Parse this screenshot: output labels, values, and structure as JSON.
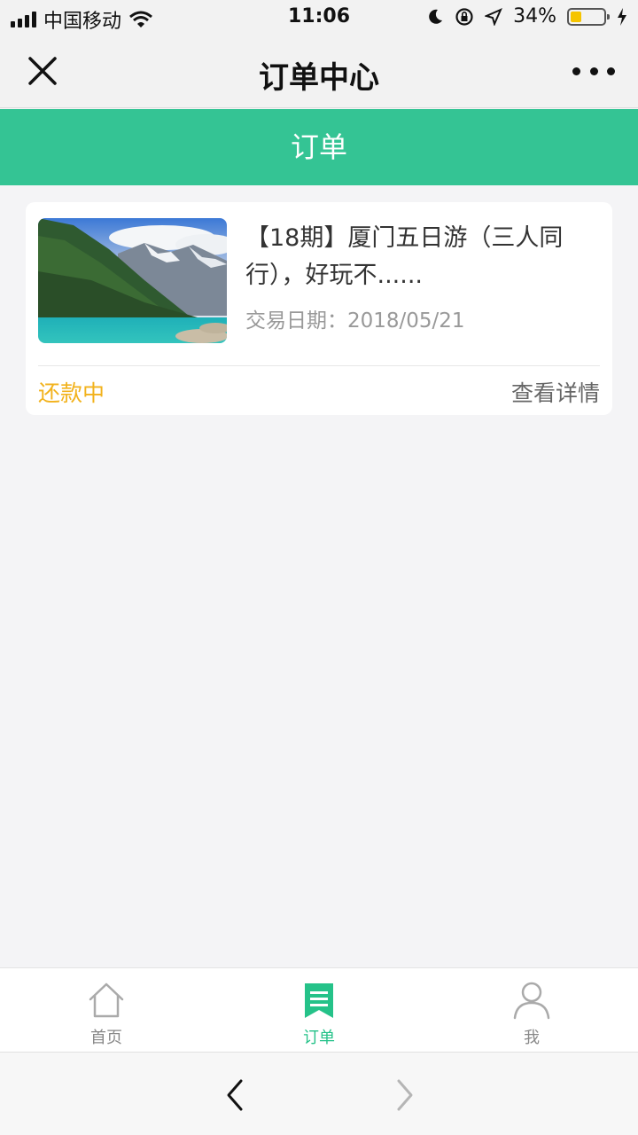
{
  "status_bar": {
    "carrier": "中国移动",
    "time": "11:06",
    "battery_percent": "34%",
    "battery_level": 0.34,
    "icons": [
      "signal-icon",
      "wifi-icon",
      "moon-icon",
      "rotation-lock-icon",
      "location-icon",
      "battery-icon",
      "charging-icon"
    ]
  },
  "nav": {
    "title": "订单中心",
    "close_icon": "close-icon",
    "more_icon": "more-dots-icon"
  },
  "header": {
    "title": "订单"
  },
  "orders": [
    {
      "title": "【18期】厦门五日游（三人同行），好玩不......",
      "date_label": "交易日期：",
      "date": "2018/05/21",
      "status": "还款中",
      "detail_link": "查看详情"
    }
  ],
  "tabs": [
    {
      "label": "首页",
      "icon": "home-icon",
      "active": false
    },
    {
      "label": "订单",
      "icon": "order-icon",
      "active": true
    },
    {
      "label": "我",
      "icon": "user-icon",
      "active": false
    }
  ],
  "browser": {
    "back_icon": "back-arrow-icon",
    "forward_icon": "forward-arrow-icon"
  },
  "colors": {
    "accent": "#34c494",
    "tab_active": "#25c289",
    "status_pending": "#f2b21c",
    "battery": "#f5c400"
  }
}
